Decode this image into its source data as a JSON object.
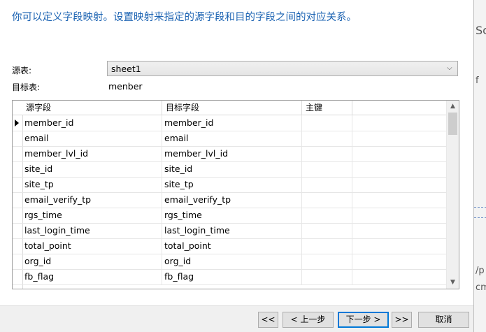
{
  "instruction": "你可以定义字段映射。设置映射来指定的源字段和目的字段之间的对应关系。",
  "source_table": {
    "label": "源表:",
    "value": "sheet1"
  },
  "target_table": {
    "label": "目标表:",
    "value": "menber"
  },
  "grid": {
    "headers": [
      "源字段",
      "目标字段",
      "主键"
    ],
    "rows": [
      {
        "source": "member_id",
        "target": "member_id",
        "key": ""
      },
      {
        "source": "email",
        "target": "email",
        "key": ""
      },
      {
        "source": "member_lvl_id",
        "target": "member_lvl_id",
        "key": ""
      },
      {
        "source": "site_id",
        "target": "site_id",
        "key": ""
      },
      {
        "source": "site_tp",
        "target": "site_tp",
        "key": ""
      },
      {
        "source": "email_verify_tp",
        "target": "email_verify_tp",
        "key": ""
      },
      {
        "source": "rgs_time",
        "target": "rgs_time",
        "key": ""
      },
      {
        "source": "last_login_time",
        "target": "last_login_time",
        "key": ""
      },
      {
        "source": "total_point",
        "target": "total_point",
        "key": ""
      },
      {
        "source": "org_id",
        "target": "org_id",
        "key": ""
      },
      {
        "source": "fb_flag",
        "target": "fb_flag",
        "key": ""
      }
    ]
  },
  "buttons": {
    "first": "<<",
    "prev": "< 上一步",
    "next": "下一步 >",
    "last": ">>",
    "cancel": "取消"
  },
  "right_strip": [
    "Sc",
    "f",
    "/p",
    "cm"
  ]
}
